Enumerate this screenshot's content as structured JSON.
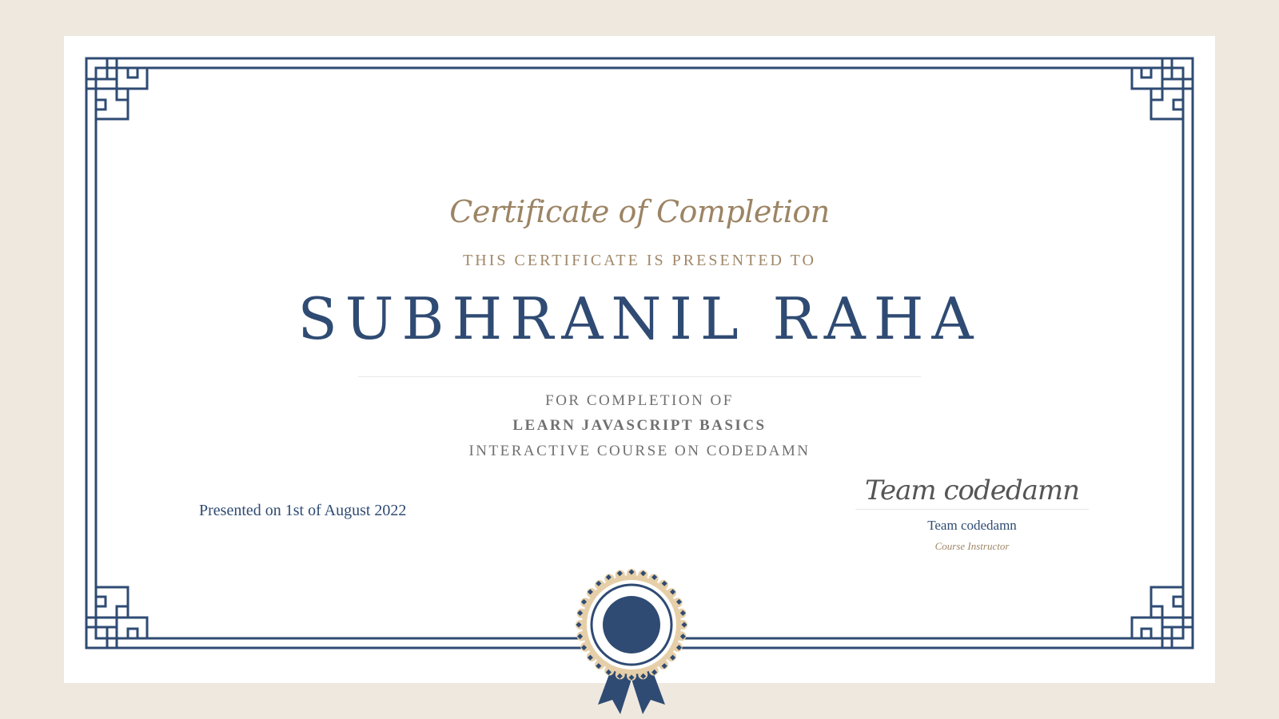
{
  "certificate": {
    "title": "Certificate of Completion",
    "presented_to_label": "THIS CERTIFICATE IS PRESENTED TO",
    "recipient_name": "SUBHRANIL RAHA",
    "for_completion_label": "FOR COMPLETION OF",
    "course_name": "LEARN JAVASCRIPT BASICS",
    "course_description": "INTERACTIVE COURSE ON CODEDAMN",
    "presented_on": "Presented on 1st of August 2022",
    "signature": "Team codedamn",
    "signer_name": "Team codedamn",
    "signer_role": "Course Instructor"
  },
  "colors": {
    "background": "#efe8df",
    "primary_blue": "#2f4b73",
    "gold": "#9c8464",
    "gray_text": "#707070",
    "seal_gold": "#e6cfa8"
  },
  "icons": {
    "corner_ornament": "greek-key-corner-icon",
    "seal": "award-ribbon-seal-icon"
  }
}
